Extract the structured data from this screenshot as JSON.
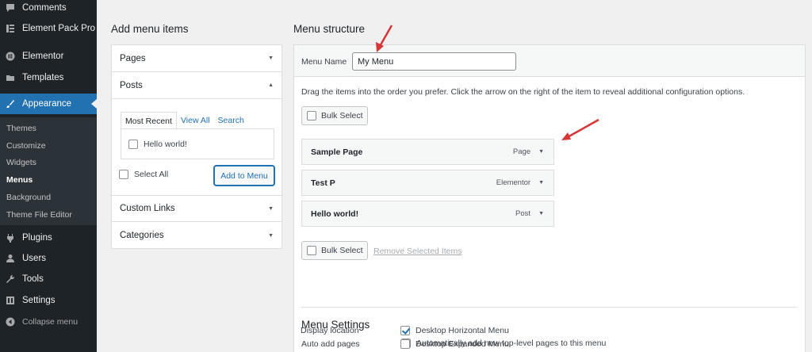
{
  "sidebar": {
    "items": [
      {
        "label": "Comments",
        "icon": "comment-icon"
      },
      {
        "label": "Element Pack Pro",
        "icon": "element-pack-icon"
      },
      {
        "label": "Elementor",
        "icon": "elementor-icon"
      },
      {
        "label": "Templates",
        "icon": "folder-icon"
      },
      {
        "label": "Appearance",
        "icon": "brush-icon"
      },
      {
        "label": "Plugins",
        "icon": "plugin-icon"
      },
      {
        "label": "Users",
        "icon": "user-icon"
      },
      {
        "label": "Tools",
        "icon": "wrench-icon"
      },
      {
        "label": "Settings",
        "icon": "settings-icon"
      },
      {
        "label": "Collapse menu",
        "icon": "collapse-icon"
      }
    ],
    "submenu": [
      "Themes",
      "Customize",
      "Widgets",
      "Menus",
      "Background",
      "Theme File Editor"
    ],
    "current_submenu": "Menus"
  },
  "left": {
    "title": "Add menu items",
    "sections": [
      "Pages",
      "Posts",
      "Custom Links",
      "Categories"
    ],
    "tabs": [
      "Most Recent",
      "View All",
      "Search"
    ],
    "posts": [
      {
        "label": "Hello world!",
        "checked": false
      }
    ],
    "select_all": "Select All",
    "add_button": "Add to Menu"
  },
  "structure": {
    "title": "Menu structure",
    "name_label": "Menu Name",
    "name_value": "My Menu",
    "instructions": "Drag the items into the order you prefer. Click the arrow on the right of the item to reveal additional configuration options.",
    "bulk_select": "Bulk Select",
    "items": [
      {
        "title": "Sample Page",
        "type": "Page"
      },
      {
        "title": "Test P",
        "type": "Elementor"
      },
      {
        "title": "Hello world!",
        "type": "Post"
      }
    ],
    "remove_selected": "Remove Selected Items"
  },
  "settings": {
    "title": "Menu Settings",
    "auto_add_label": "Auto add pages",
    "auto_add_option": "Automatically add new top-level pages to this menu",
    "auto_add_checked": false,
    "display_location_label": "Display location",
    "locations": [
      {
        "label": "Desktop Horizontal Menu",
        "checked": true
      },
      {
        "label": "Desktop Expanded Menu",
        "checked": false
      }
    ]
  },
  "colors": {
    "sidebar_bg": "#1d2327",
    "accent": "#2271b1",
    "annotation": "#d63638"
  }
}
